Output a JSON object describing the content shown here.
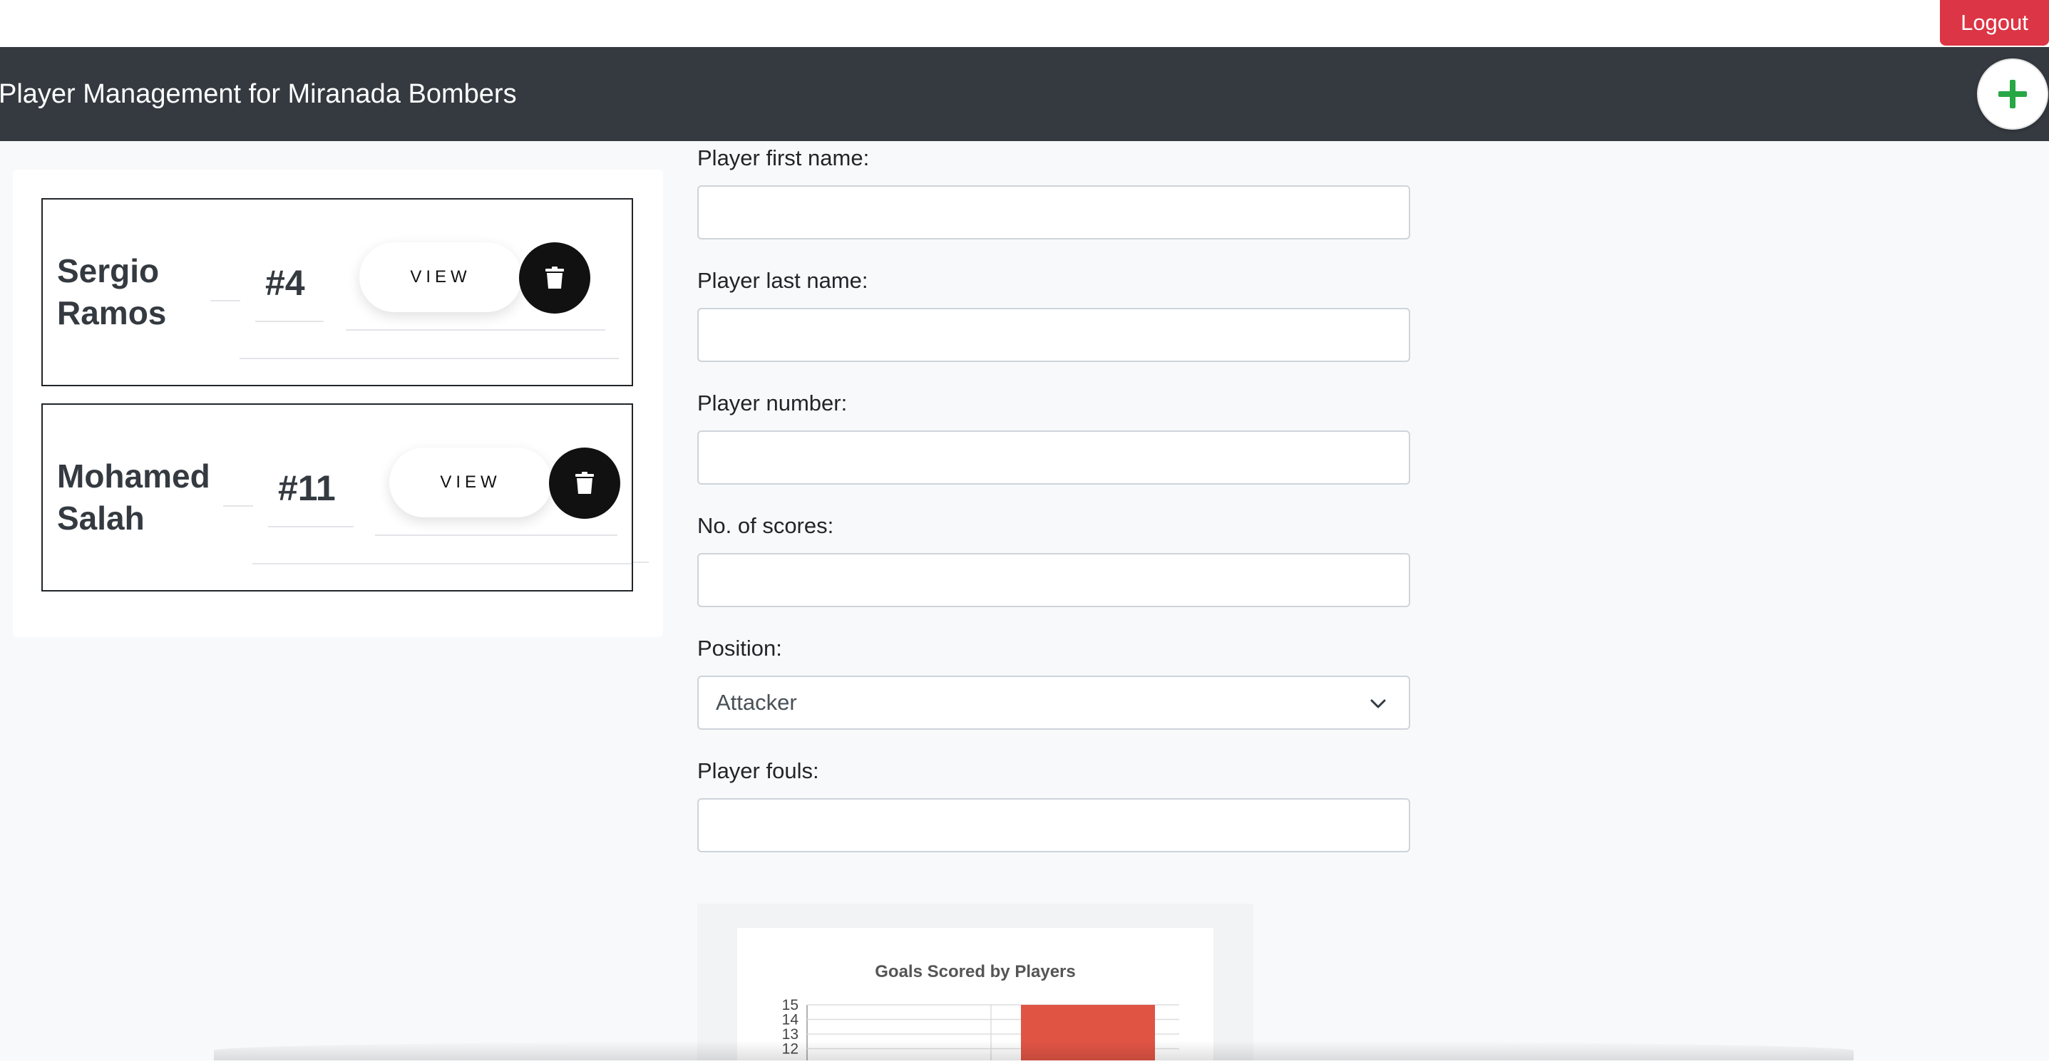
{
  "topbar": {
    "logout_label": "Logout",
    "logout_color": "#dc3545"
  },
  "header": {
    "title": "Player Management for Miranada Bombers",
    "add_icon": "plus-icon",
    "add_icon_color": "#28a745"
  },
  "players": [
    {
      "first_name": "Sergio",
      "last_name": "Ramos",
      "number": "#4",
      "view_label": "VIEW",
      "delete_icon": "trash-icon"
    },
    {
      "first_name": "Mohamed",
      "last_name": "Salah",
      "number": "#11",
      "view_label": "VIEW",
      "delete_icon": "trash-icon"
    }
  ],
  "form": {
    "first_name_label": "Player first name:",
    "first_name_value": "",
    "last_name_label": "Player last name:",
    "last_name_value": "",
    "number_label": "Player number:",
    "number_value": "",
    "scores_label": "No. of scores:",
    "scores_value": "",
    "position_label": "Position:",
    "position_value": "Attacker",
    "fouls_label": "Player fouls:",
    "fouls_value": ""
  },
  "chart_data": {
    "type": "bar",
    "title": "Goals Scored by Players",
    "ylim_visible": [
      11,
      15
    ],
    "yticks": [
      "15",
      "14",
      "13",
      "12"
    ],
    "series": [
      {
        "values": [
          15
        ],
        "color": "#e05444"
      }
    ],
    "grid": true
  }
}
